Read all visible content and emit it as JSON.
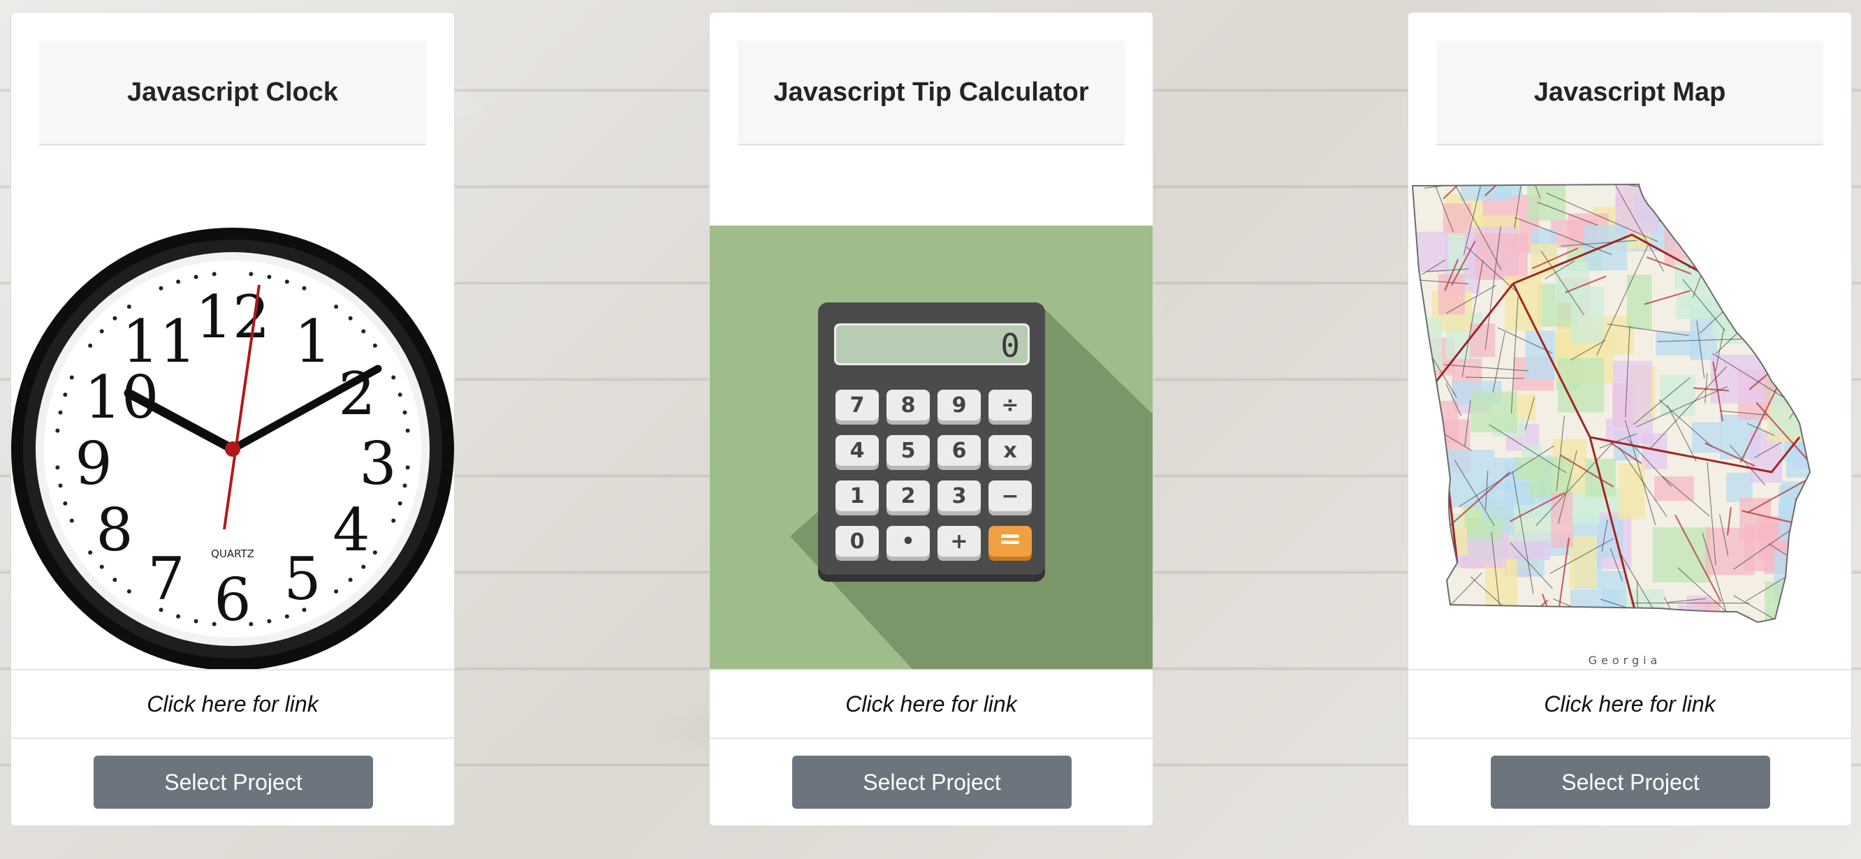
{
  "cards": [
    {
      "title": "Javascript Clock",
      "image": {
        "subject": "analog wall clock",
        "icon": "clock-icon",
        "numerals": [
          "12",
          "1",
          "2",
          "3",
          "4",
          "5",
          "6",
          "7",
          "8",
          "9",
          "10",
          "11"
        ],
        "brand": "QUARTZ"
      },
      "link_label": "Click here for link",
      "button_label": "Select Project"
    },
    {
      "title": "Javascript Tip Calculator",
      "image": {
        "subject": "flat calculator illustration",
        "icon": "calculator-icon",
        "display": "0",
        "keys": [
          "7",
          "8",
          "9",
          "÷",
          "4",
          "5",
          "6",
          "x",
          "1",
          "2",
          "3",
          "−",
          "0",
          "•",
          "+",
          "="
        ],
        "colors": {
          "background": "#9fbd8a",
          "body": "#4b4b4b",
          "equals_key": "#f0a040"
        }
      },
      "link_label": "Click here for link",
      "button_label": "Select Project"
    },
    {
      "title": "Javascript Map",
      "image": {
        "subject": "road map of Georgia",
        "icon": "map-icon",
        "caption": "Georgia"
      },
      "link_label": "Click here for link",
      "button_label": "Select Project"
    }
  ],
  "colors": {
    "button": "#6c757d",
    "header_bg": "#f7f7f7"
  }
}
